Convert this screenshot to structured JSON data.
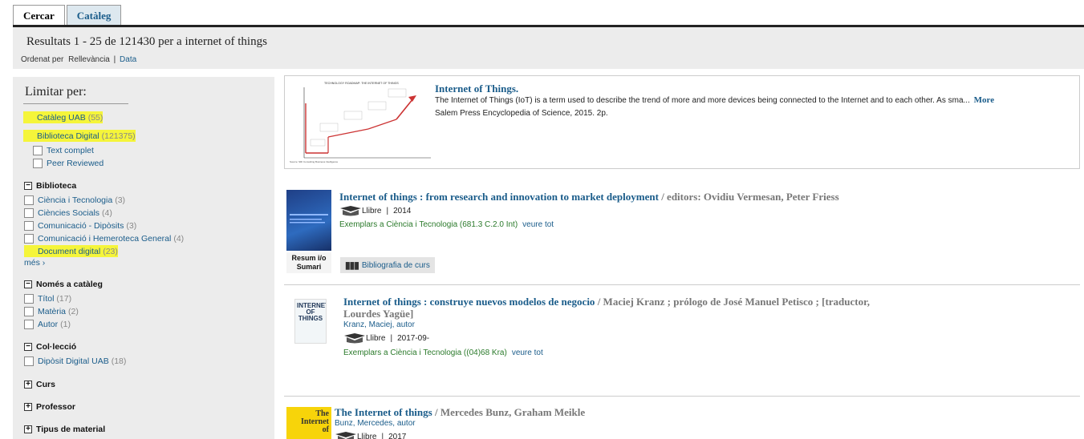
{
  "tabs": [
    {
      "label": "Cercar",
      "active": true
    },
    {
      "label": "Catàleg",
      "active": false
    }
  ],
  "results_header": {
    "title": "Resultats 1 - 25 de 121430 per a internet of things",
    "sort_prefix": "Ordenat per",
    "sort_relevance": "Rellevància",
    "sort_separator": "|",
    "sort_date": "Data"
  },
  "sidebar": {
    "title": "Limitar per:",
    "top_facets": [
      {
        "label": "Catàleg UAB",
        "count": "(55)"
      },
      {
        "label": "Biblioteca Digital",
        "count": "(121375)"
      }
    ],
    "sub_facets": [
      {
        "label": "Text complet"
      },
      {
        "label": "Peer Reviewed"
      }
    ],
    "groups": {
      "biblioteca": {
        "label": "Biblioteca",
        "toggle": "−",
        "items": [
          {
            "label": "Ciència i Tecnologia",
            "count": "(3)"
          },
          {
            "label": "Ciències Socials",
            "count": "(4)"
          },
          {
            "label": "Comunicació - Dipòsits",
            "count": "(3)"
          },
          {
            "label": "Comunicació i Hemeroteca General",
            "count": "(4)"
          },
          {
            "label": "Document digital",
            "count": "(23)"
          }
        ],
        "more": "més  ›"
      },
      "cataleg": {
        "label": "Només a catàleg",
        "toggle": "−",
        "items": [
          {
            "label": "Títol",
            "count": "(17)"
          },
          {
            "label": "Matèria",
            "count": "(2)"
          },
          {
            "label": "Autor",
            "count": "(1)"
          }
        ]
      },
      "colleccio": {
        "label": "Col·lecció",
        "toggle": "−",
        "items": [
          {
            "label": "Dipòsit Digital UAB",
            "count": "(18)"
          }
        ]
      },
      "curs": {
        "label": "Curs",
        "toggle": "+"
      },
      "professor": {
        "label": "Professor",
        "toggle": "+"
      },
      "tipus": {
        "label": "Tipus de material",
        "toggle": "+"
      }
    }
  },
  "featured": {
    "title": "Internet of Things.",
    "snippet": "The Internet of Things (IoT) is a term used to describe the trend of more and more devices being connected to the Internet and to each other. As sma...",
    "more": "More",
    "source": "Salem Press Encyclopedia of Science, 2015. 2p.",
    "thumb_title": "TECHNOLOGY ROADMAP: THE INTERNET OF THINGS",
    "thumb_source": "Source: SRI Consulting Business Intelligence"
  },
  "records": [
    {
      "title": "Internet of things : from research and innovation to market deployment",
      "responsibility": " / editors: Ovidiu Vermesan, Peter Friess",
      "format": "Llibre",
      "sep": "|",
      "date": "2014",
      "holdings_prefix": "Exemplars",
      "holdings": " a Ciència i Tecnologia (681.3 C.2.0 Int)",
      "see_all": "veure tot",
      "resum": "Resum i/o Sumari",
      "bib_button": "Bibliografia de curs"
    },
    {
      "title": "Internet of things : construye nuevos modelos de negocio",
      "responsibility": " / Maciej Kranz ; prólogo de José Manuel Petisco ; [traductor,",
      "title_line2": "Lourdes Yagüe]",
      "author": "Kranz, Maciej, autor",
      "format": "Llibre",
      "sep": "|",
      "date": "2017-09-",
      "holdings_prefix": "Exemplars",
      "holdings": " a Ciència i Tecnologia ((04)68 Kra)",
      "see_all": "veure tot",
      "cover_text": "INTERNET OF THINGS"
    },
    {
      "title": "The Internet of things",
      "responsibility": " / Mercedes Bunz, Graham Meikle",
      "author": "Bunz, Mercedes, autor",
      "format": "Llibre",
      "sep": "|",
      "date": "2017",
      "cover_text_1": "The",
      "cover_text_2": "Internet",
      "cover_text_3": "of"
    }
  ],
  "colors": {
    "link": "#1a5c8a",
    "highlight": "#f5f53a",
    "holdings_green": "#2b7a2b",
    "sidebar_bg": "#ececec"
  }
}
